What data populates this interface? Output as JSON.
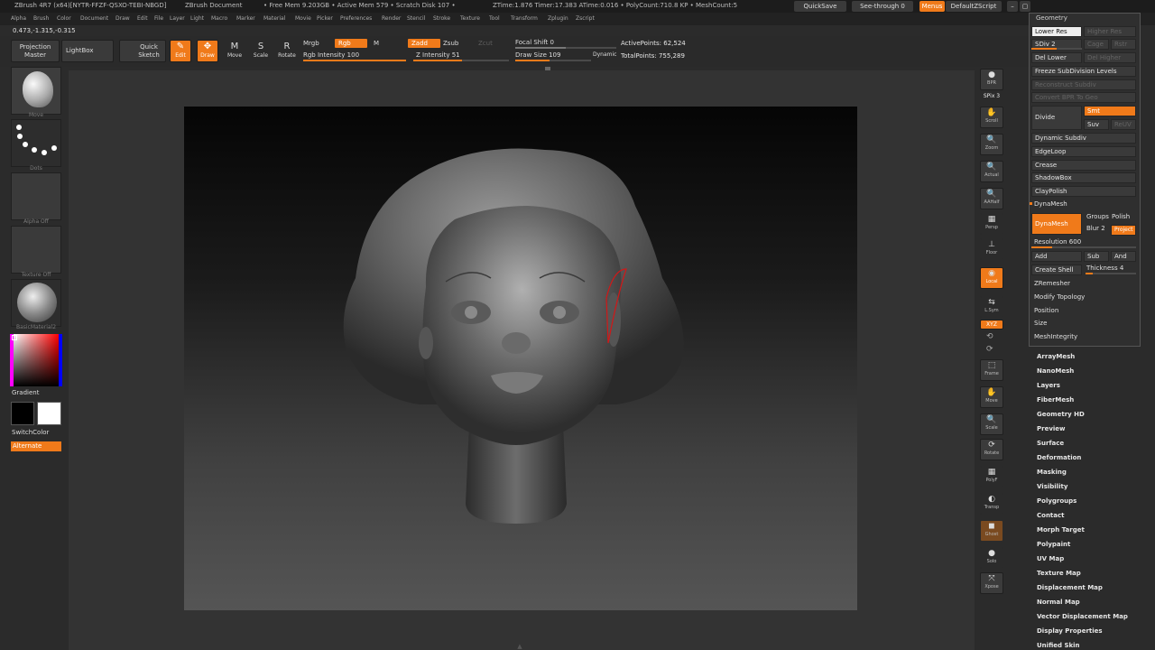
{
  "titlebar": {
    "app": "ZBrush 4R7 (x64)[NYTR-FFZF-QSXO-TEBI-NBGD]",
    "doc": "ZBrush Document",
    "mem": "• Free Mem 9.203GB • Active Mem 579 • Scratch Disk 107 •",
    "timing": "ZTime:1.876 Timer:17.383 ATime:0.016 • PolyCount:710.8 KP • MeshCount:5",
    "quicksave": "QuickSave",
    "seethrough": "See-through  0",
    "menus": "Menus",
    "zscript": "DefaultZScript"
  },
  "menus": [
    "Alpha",
    "Brush",
    "Color",
    "Document",
    "Draw",
    "Edit",
    "File",
    "Layer",
    "Light",
    "Macro",
    "Marker",
    "Material",
    "Movie",
    "Picker",
    "Preferences",
    "Render",
    "Stencil",
    "Stroke",
    "Texture",
    "Tool",
    "Transform",
    "Zplugin",
    "Zscript"
  ],
  "coords": "0.473,-1.315,-0.315",
  "toolbar": {
    "projection_master": "Projection\nMaster",
    "lightbox": "LightBox",
    "quick_sketch": "Quick\nSketch",
    "edit": "Edit",
    "draw": "Draw",
    "move": "Move",
    "scale": "Scale",
    "rotate": "Rotate",
    "mrgb": "Mrgb",
    "rgb": "Rgb",
    "m": "M",
    "zadd": "Zadd",
    "zsub": "Zsub",
    "zcut": "Zcut",
    "rgb_intensity": "Rgb Intensity 100",
    "z_intensity": "Z Intensity 51",
    "focal_shift": "Focal Shift 0",
    "draw_size": "Draw Size 109",
    "dynamic": "Dynamic",
    "active_points": "ActivePoints: 62,524",
    "total_points": "TotalPoints: 755,289"
  },
  "left_shelf": {
    "brush": "Move",
    "stroke": "Dots",
    "alpha": "Alpha Off",
    "texture": "Texture Off",
    "material": "BasicMaterial2",
    "gradient": "Gradient",
    "switchcolor": "SwitchColor",
    "alternate": "Alternate"
  },
  "right_shelf": [
    {
      "label": "BPR",
      "icon": "●"
    },
    {
      "label": "SPix 3",
      "icon": ""
    },
    {
      "label": "Scroll",
      "icon": "✋"
    },
    {
      "label": "Zoom",
      "icon": "🔍"
    },
    {
      "label": "Actual",
      "icon": "🔍"
    },
    {
      "label": "AAHalf",
      "icon": "🔍"
    },
    {
      "label": "Persp",
      "icon": "▦"
    },
    {
      "label": "Floor",
      "icon": "⊥"
    },
    {
      "label": "Local",
      "icon": "◉"
    },
    {
      "label": "L.Sym",
      "icon": "⇆"
    },
    {
      "label": "XYZ",
      "icon": "⟲"
    },
    {
      "label": "Frame",
      "icon": "⬚"
    },
    {
      "label": "Move",
      "icon": "✋"
    },
    {
      "label": "Scale",
      "icon": "🔍"
    },
    {
      "label": "Rotate",
      "icon": "⟳"
    },
    {
      "label": "PolyF",
      "icon": "▦"
    },
    {
      "label": "Transp",
      "icon": "◐"
    },
    {
      "label": "Ghost",
      "icon": "◼"
    },
    {
      "label": "Solo",
      "icon": "●"
    },
    {
      "label": "Xpose",
      "icon": "⤧"
    }
  ],
  "geometry": {
    "title": "Geometry",
    "lower_res": "Lower Res",
    "higher_res": "Higher Res",
    "sdiv": "SDiv 2",
    "cage": "Cage",
    "rstr": "Rstr",
    "del_lower": "Del Lower",
    "del_higher": "Del Higher",
    "freeze": "Freeze SubDivision Levels",
    "reconstruct": "Reconstruct Subdiv",
    "convert_bpr": "Convert BPR To Geo",
    "divide": "Divide",
    "smt": "Smt",
    "suv": "Suv",
    "reuv": "ReUV",
    "dynamic_subdiv": "Dynamic Subdiv",
    "edgeloop": "EdgeLoop",
    "crease": "Crease",
    "shadowbox": "ShadowBox",
    "claypolish": "ClayPolish",
    "dynamesh_head": "DynaMesh",
    "dynamesh_btn": "DynaMesh",
    "groups": "Groups",
    "polish": "Polish",
    "blur": "Blur 2",
    "project": "Project",
    "resolution": "Resolution 600",
    "add": "Add",
    "sub": "Sub",
    "and": "And",
    "create_shell": "Create Shell",
    "thickness": "Thickness 4",
    "zremesher": "ZRemesher",
    "modify_topology": "Modify Topology",
    "position": "Position",
    "size": "Size",
    "mesh_integrity": "MeshIntegrity"
  },
  "subpalettes": [
    "ArrayMesh",
    "NanoMesh",
    "Layers",
    "FiberMesh",
    "Geometry HD",
    "Preview",
    "Surface",
    "Deformation",
    "Masking",
    "Visibility",
    "Polygroups",
    "Contact",
    "Morph Target",
    "Polypaint",
    "UV Map",
    "Texture Map",
    "Displacement Map",
    "Normal Map",
    "Vector Displacement Map",
    "Display Properties",
    "Unified Skin"
  ]
}
